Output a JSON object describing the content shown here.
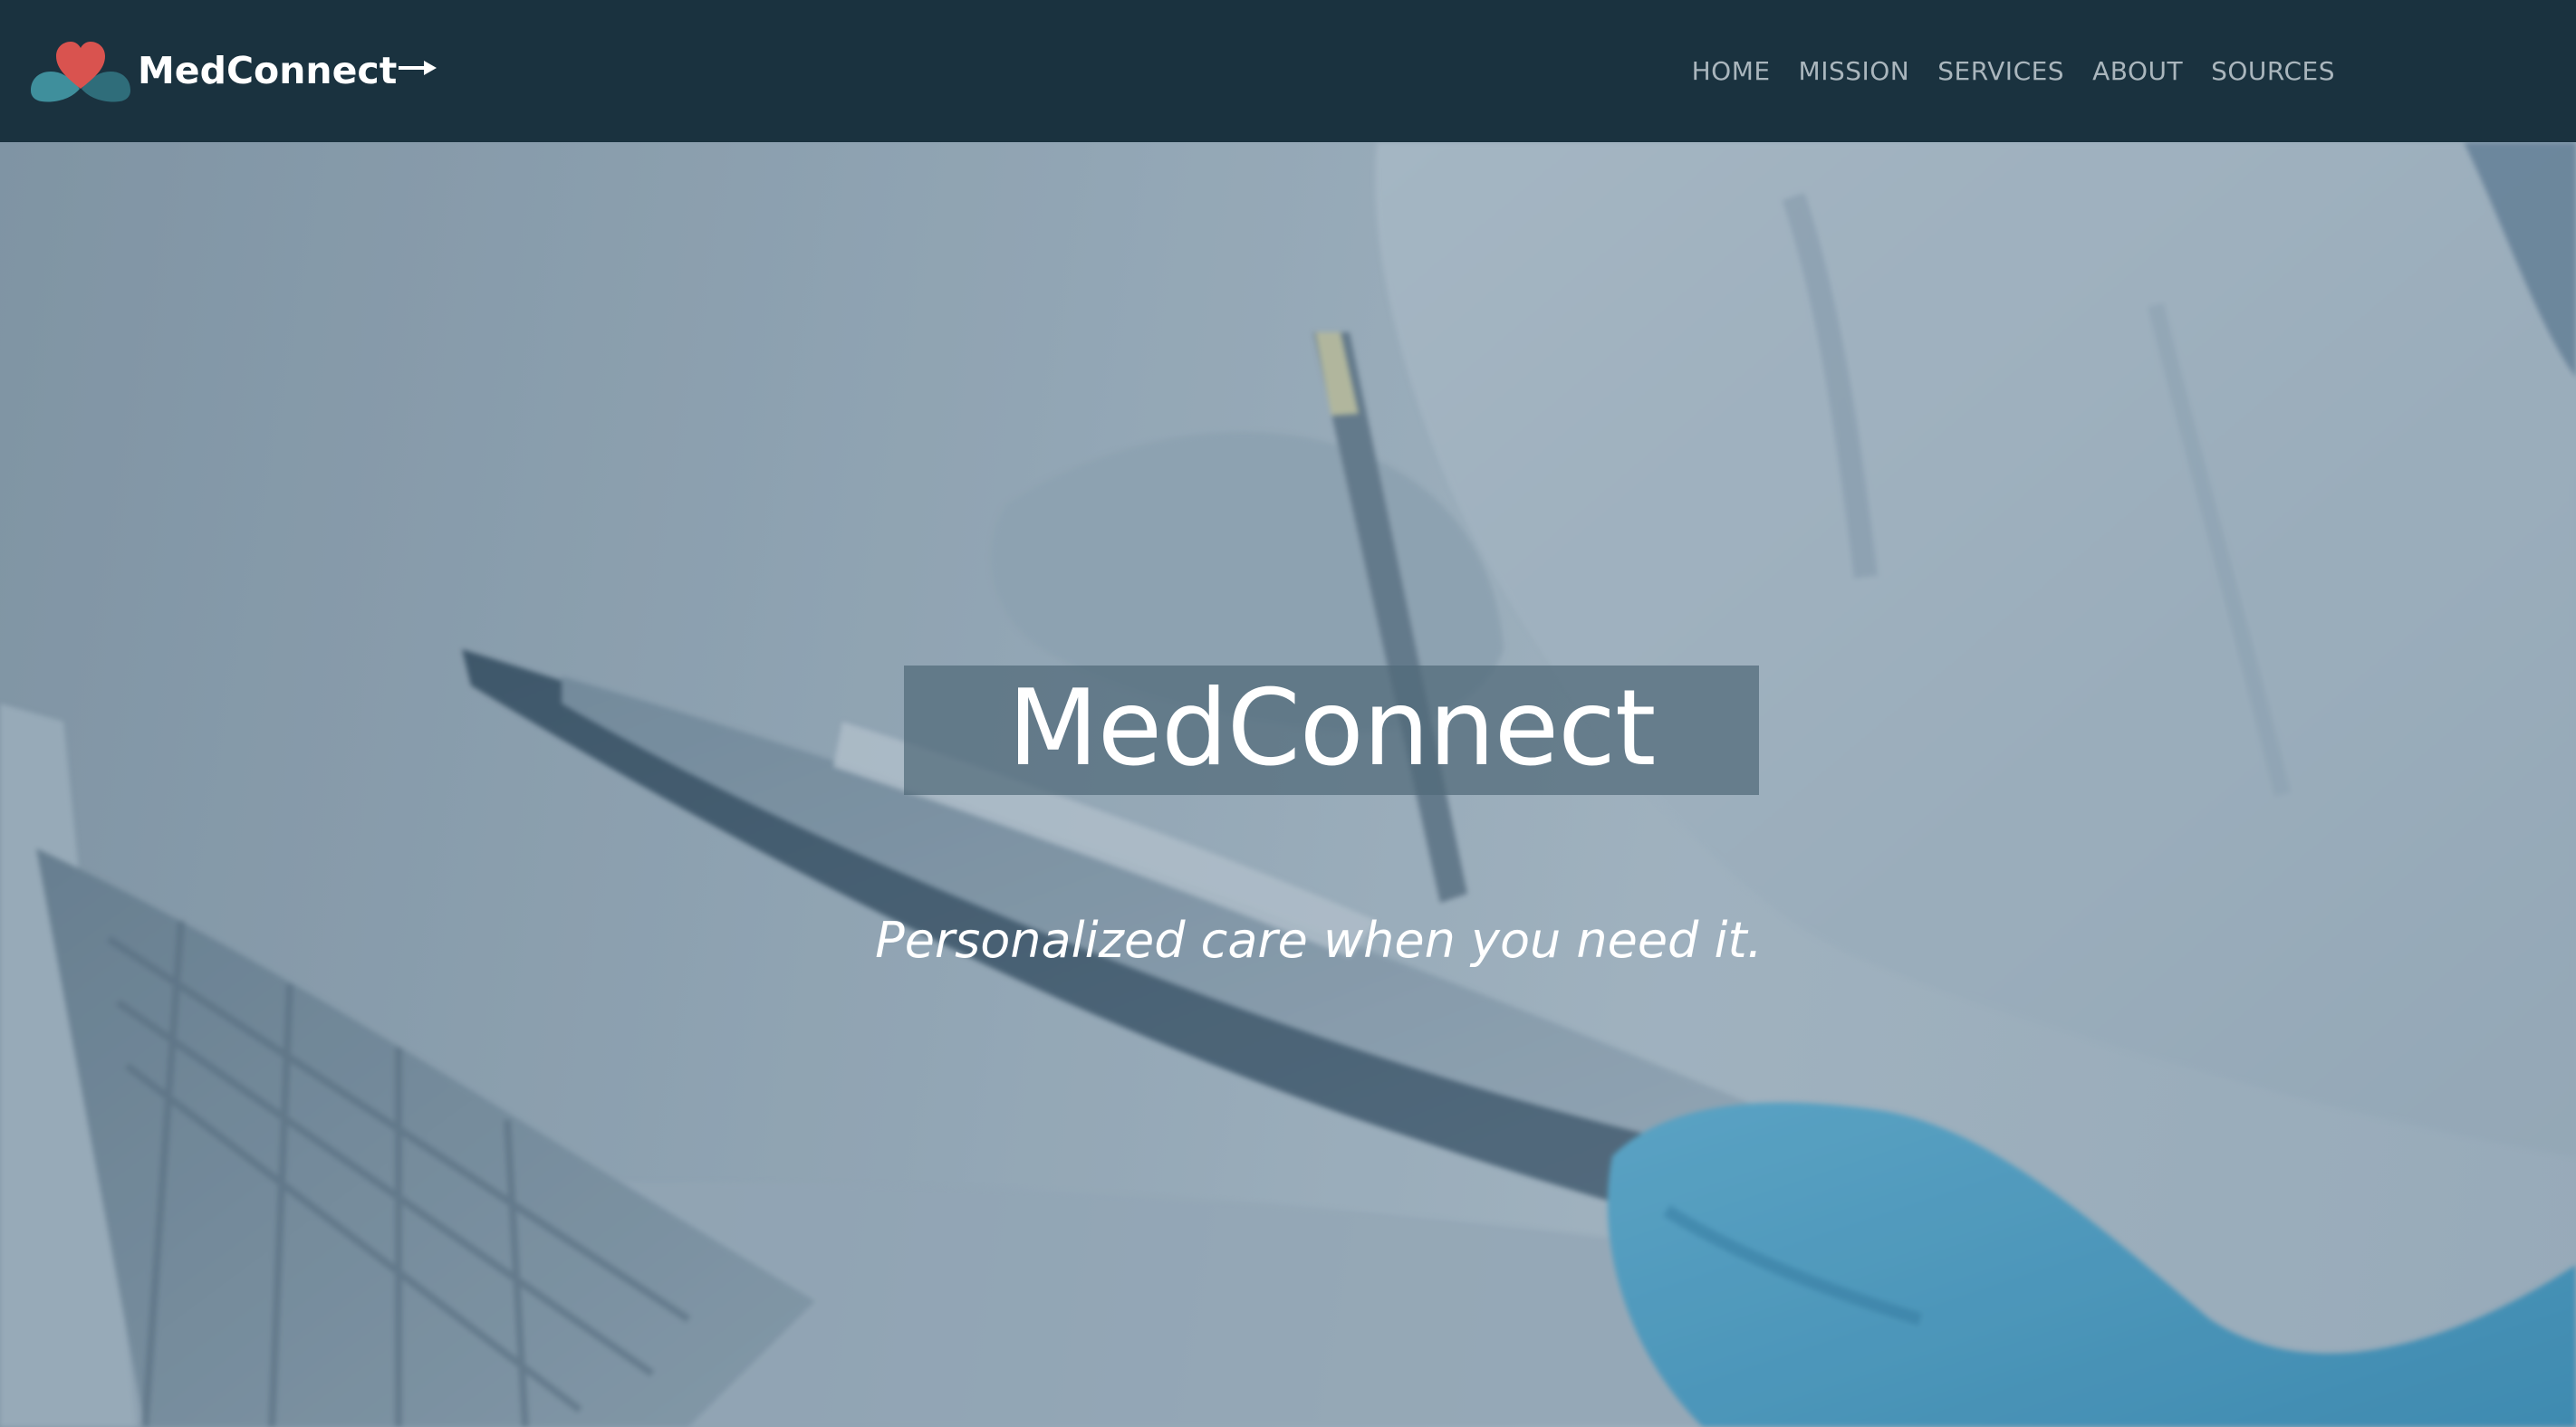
{
  "brand": {
    "name": "MedConnect",
    "logo_icon": "heart-hands-icon",
    "arrow_icon": "arrow-right-icon"
  },
  "nav": {
    "items": [
      {
        "label": "HOME"
      },
      {
        "label": "MISSION"
      },
      {
        "label": "SERVICES"
      },
      {
        "label": "ABOUT"
      },
      {
        "label": "SOURCES"
      }
    ]
  },
  "hero": {
    "title": "MedConnect",
    "tagline": "Personalized care when you need it.",
    "background_image": "doctor-with-clipboard-photo"
  },
  "colors": {
    "navbar_bg": "#1a323f",
    "nav_text": "#aab6bd",
    "heart": "#d9534f",
    "hands": "#3f8f9c",
    "glove": "#4aa3c8"
  }
}
